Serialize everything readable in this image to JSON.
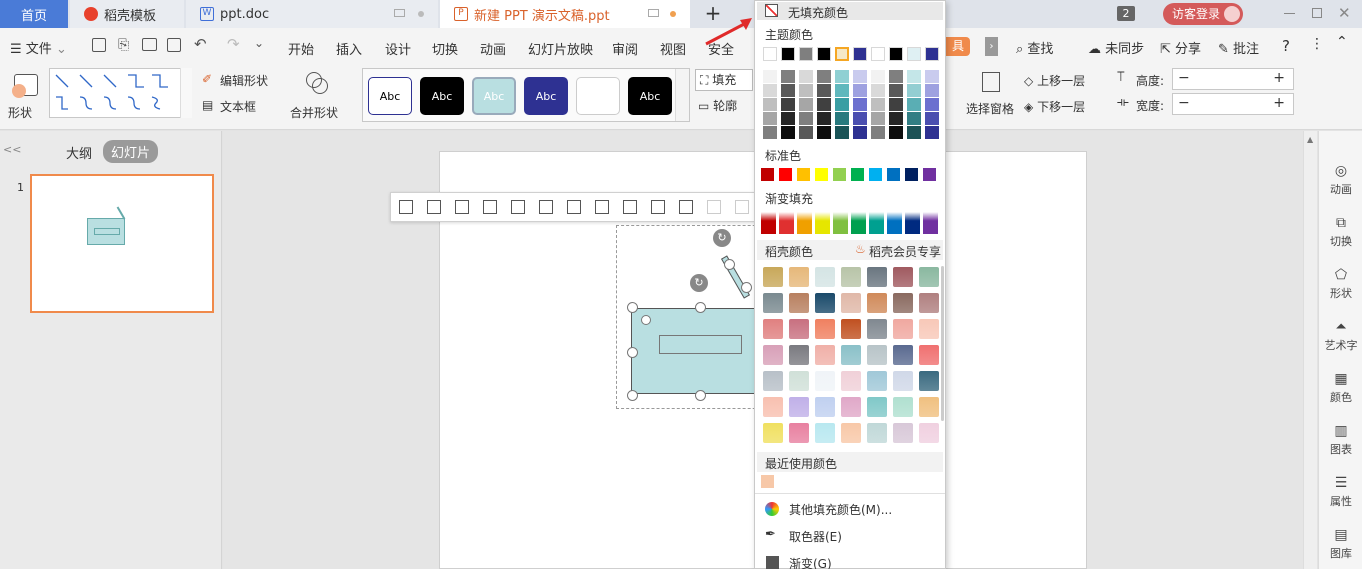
{
  "tabs": {
    "home": "首页",
    "templates": "稻壳模板",
    "doc": "ppt.doc",
    "ppt": "新建 PPT 演示文稿.ppt",
    "add": "+",
    "count_badge": "2",
    "login": "访客登录"
  },
  "menu": {
    "file": "文件",
    "items": [
      "开始",
      "插入",
      "设计",
      "切换",
      "动画",
      "幻灯片放映",
      "审阅",
      "视图",
      "安全"
    ],
    "tool_badge": "具",
    "search": "查找",
    "sync": "未同步",
    "share": "分享",
    "comment": "批注",
    "help": "?"
  },
  "ribbon": {
    "shape": "形状",
    "edit_shape": "编辑形状",
    "text_box": "文本框",
    "merge_shape": "合并形状",
    "style_labels": [
      "Abc",
      "Abc",
      "Abc",
      "Abc",
      "",
      "Abc"
    ],
    "fill": "填充",
    "outline": "轮廓",
    "select_pane": "选择窗格",
    "bring_forward": "上移一层",
    "send_backward": "下移一层",
    "height_label": "高度:",
    "width_label": "宽度:",
    "minus": "−",
    "plus": "+"
  },
  "left_panel": {
    "collapse": "<<",
    "outline_tab": "大纲",
    "slides_tab": "幻灯片",
    "slide_number": "1"
  },
  "right_bar": [
    "动画",
    "切换",
    "形状",
    "艺术字",
    "颜色",
    "图表",
    "属性",
    "图库"
  ],
  "dropdown": {
    "no_fill": "无填充颜色",
    "theme_colors": "主题颜色",
    "standard_colors": "标准色",
    "gradient_fill": "渐变填充",
    "docer_colors": "稻壳颜色",
    "docer_vip": "稻壳会员专享",
    "recent_colors": "最近使用颜色",
    "more_colors": "其他填充颜色(M)...",
    "picker": "取色器(E)",
    "gradient": "渐变(G)"
  },
  "colors": {
    "theme_top": [
      "#ffffff",
      "#000000",
      "#7f7f7f",
      "#000000",
      "#f5e8c8",
      "#2e3192",
      "#ffffff",
      "#000000",
      "#dff0f3",
      "#2e3192"
    ],
    "standard": [
      "#c00000",
      "#ff0000",
      "#ffc000",
      "#ffff00",
      "#92d050",
      "#00b050",
      "#00b0f0",
      "#0070c0",
      "#002060",
      "#7030a0"
    ],
    "gradient": [
      "#c00000",
      "#e03030",
      "#f0a000",
      "#e6e600",
      "#80c040",
      "#00a050",
      "#00a090",
      "#0070c0",
      "#002a80",
      "#7030a0"
    ],
    "recent": [
      "#f7c8a8"
    ],
    "shape_fill": "#b9dfe1",
    "accent": "#4a7bd7"
  }
}
